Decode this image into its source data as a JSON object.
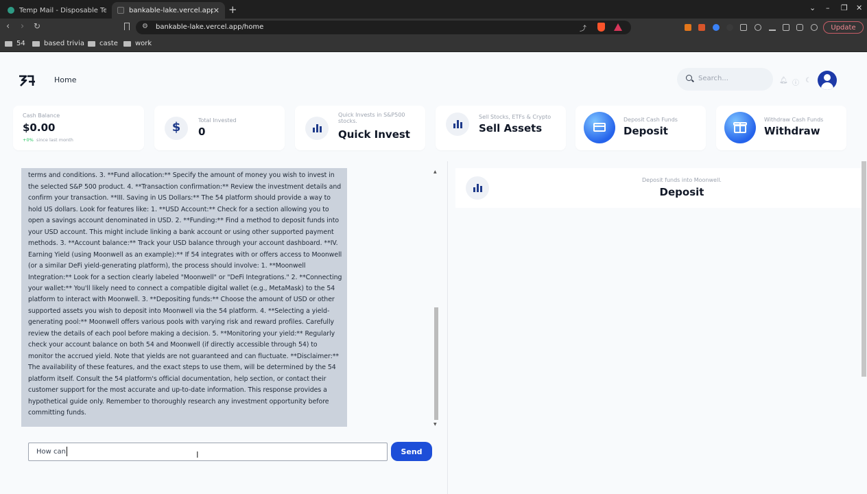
{
  "browser": {
    "tabs": [
      {
        "title": "Temp Mail - Disposable Tem"
      },
      {
        "title": "bankable-lake.vercel.app/"
      }
    ],
    "url": "bankable-lake.vercel.app/home",
    "update_label": "Update",
    "bookmarks": [
      "54",
      "based trivia",
      "caste",
      "work"
    ]
  },
  "header": {
    "home_label": "Home",
    "search_placeholder": "Search..."
  },
  "cards": {
    "cash": {
      "label": "Cash Balance",
      "value": "$0.00",
      "change": "+0%",
      "change_note": "since last month"
    },
    "invested": {
      "label": "Total Invested",
      "value": "0"
    },
    "quick": {
      "label": "Quick Invests in S&P500 stocks.",
      "title": "Quick Invest"
    },
    "sell": {
      "label": "Sell Stocks, ETFs & Crypto",
      "title": "Sell Assets"
    },
    "deposit": {
      "label": "Deposit Cash Funds",
      "title": "Deposit"
    },
    "withdraw": {
      "label": "Withdraw Cash Funds",
      "title": "Withdraw"
    }
  },
  "chat": {
    "message": "Regulatory requirements, and then follow the platform's specific instructions and agree to any terms and conditions. 3. **Fund allocation:** Specify the amount of money you wish to invest in the selected S&P 500 product. 4. **Transaction confirmation:** Review the investment details and confirm your transaction. **III. Saving in US Dollars:** The 54 platform should provide a way to hold US dollars. Look for features like: 1. **USD Account:** Check for a section allowing you to open a savings account denominated in USD. 2. **Funding:** Find a method to deposit funds into your USD account. This might include linking a bank account or using other supported payment methods. 3. **Account balance:** Track your USD balance through your account dashboard. **IV. Earning Yield (using Moonwell as an example):** If 54 integrates with or offers access to Moonwell (or a similar DeFi yield-generating platform), the process should involve: 1. **Moonwell Integration:** Look for a section clearly labeled \"Moonwell\" or \"DeFi Integrations.\" 2. **Connecting your wallet:** You'll likely need to connect a compatible digital wallet (e.g., MetaMask) to the 54 platform to interact with Moonwell. 3. **Depositing funds:** Choose the amount of USD or other supported assets you wish to deposit into Moonwell via the 54 platform. 4. **Selecting a yield-generating pool:** Moonwell offers various pools with varying risk and reward profiles. Carefully review the details of each pool before making a decision. 5. **Monitoring your yield:** Regularly check your account balance on both 54 and Moonwell (if directly accessible through 54) to monitor the accrued yield. Note that yields are not guaranteed and can fluctuate. **Disclaimer:** The availability of these features, and the exact steps to use them, will be determined by the 54 platform itself. Consult the 54 platform's official documentation, help section, or contact their customer support for the most accurate and up-to-date information. This response provides a hypothetical guide only. Remember to thoroughly research any investment opportunity before committing funds.",
    "input_value": "How can",
    "send_label": "Send"
  },
  "deposit_panel": {
    "subtitle": "Deposit funds into Moonwell.",
    "title": "Deposit"
  },
  "colors": {
    "accent": "#1d4ed8",
    "chat_bubble": "#cbd2dc",
    "update_button": "#f08a92"
  }
}
